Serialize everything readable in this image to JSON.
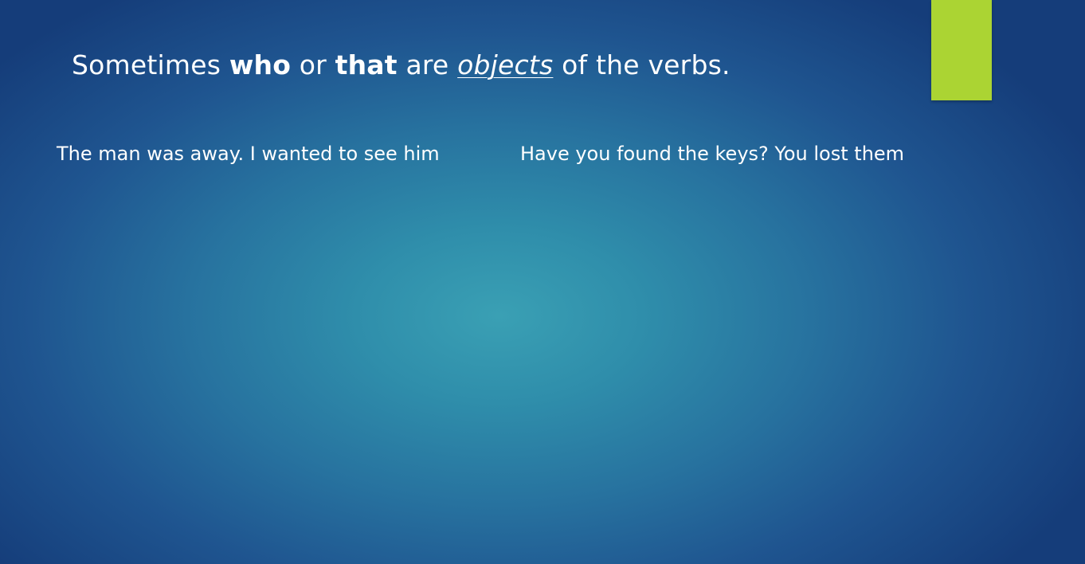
{
  "slide": {
    "title": {
      "part1": "Sometimes ",
      "who": "who",
      "part2": " or ",
      "that": "that",
      "part3": " are ",
      "objects": "objects",
      "part4": " of the verbs."
    },
    "left_text": "The man was away. I wanted to see him",
    "right_text": "Have you found the keys? You lost them",
    "accent_color": "#abd433"
  }
}
